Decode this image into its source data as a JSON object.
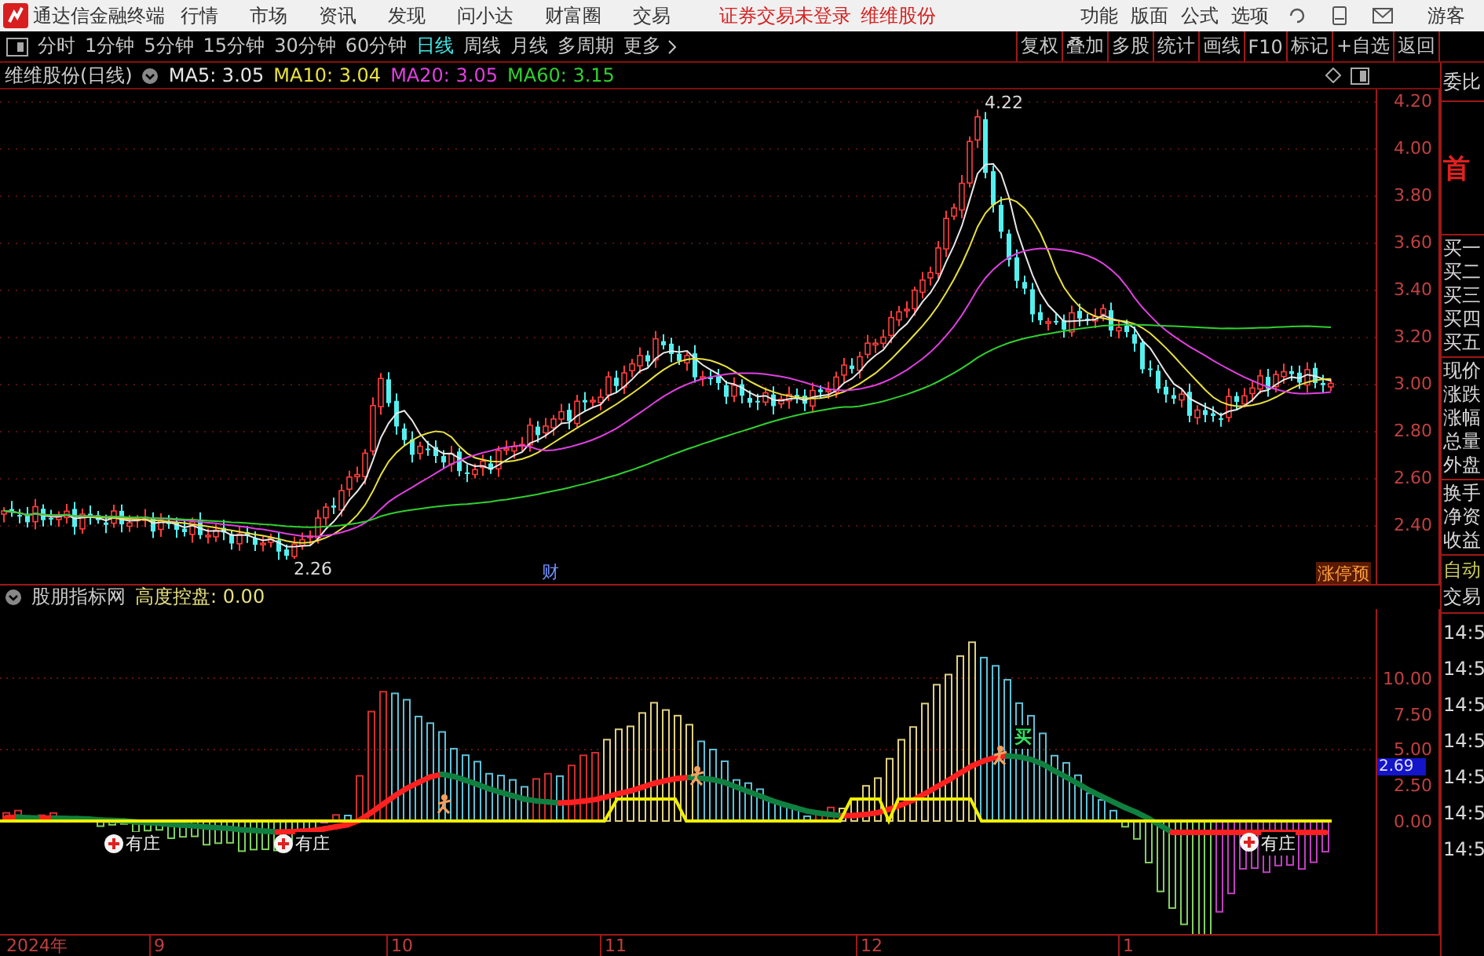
{
  "menu_bar": {
    "app_title": "通达信金融终端",
    "menus": [
      "行情",
      "市场",
      "资讯",
      "发现",
      "问小达",
      "财富圈",
      "交易"
    ],
    "login_status": "证券交易未登录",
    "stock_name": "维维股份",
    "right_menus": [
      "功能",
      "版面",
      "公式",
      "选项"
    ],
    "user": "游客"
  },
  "period_bar": {
    "periods": [
      {
        "label": "分时",
        "selected": false
      },
      {
        "label": "1分钟",
        "selected": false
      },
      {
        "label": "5分钟",
        "selected": false
      },
      {
        "label": "15分钟",
        "selected": false
      },
      {
        "label": "30分钟",
        "selected": false
      },
      {
        "label": "60分钟",
        "selected": false
      },
      {
        "label": "日线",
        "selected": true
      },
      {
        "label": "周线",
        "selected": false
      },
      {
        "label": "月线",
        "selected": false
      },
      {
        "label": "多周期",
        "selected": false
      },
      {
        "label": "更多",
        "selected": false
      }
    ],
    "tools": [
      "复权",
      "叠加",
      "多股",
      "统计",
      "画线",
      "F10",
      "标记",
      "+自选",
      "返回"
    ]
  },
  "price_chart": {
    "title": "维维股份(日线)",
    "ma": [
      {
        "label": "MA5: 3.05",
        "color": "#e8e8e8"
      },
      {
        "label": "MA10: 3.04",
        "color": "#e8e040"
      },
      {
        "label": "MA20: 3.05",
        "color": "#e040e0"
      },
      {
        "label": "MA60: 3.15",
        "color": "#30d030"
      }
    ],
    "y_labels": [
      "4.20",
      "4.00",
      "3.80",
      "3.60",
      "3.40",
      "3.20",
      "3.00",
      "2.80",
      "2.60",
      "2.40"
    ],
    "high_label": "4.22",
    "low_label": "2.26",
    "event_mark": "财",
    "badge": "涨停预"
  },
  "indicator": {
    "title": "股朋指标网",
    "value_label": "高度控盘: 0.00",
    "y_labels": [
      "10.00",
      "7.50",
      "5.00",
      "2.50",
      "0.00"
    ],
    "current_value": "2.69",
    "signals": [
      {
        "kind": "zhuang",
        "text": "有庄"
      },
      {
        "kind": "zhuang",
        "text": "有庄"
      },
      {
        "kind": "zhuang",
        "text": "有庄"
      },
      {
        "kind": "buy",
        "text": "买"
      }
    ]
  },
  "date_axis": [
    "2024年",
    "9",
    "10",
    "11",
    "12",
    "1"
  ],
  "quote_panel": {
    "sections": [
      {
        "kind": "header",
        "items": [
          "委比"
        ]
      },
      {
        "kind": "banner",
        "items": [
          "首"
        ]
      },
      {
        "kind": "rows",
        "items": [
          "买一",
          "买二",
          "买三",
          "买四",
          "买五"
        ]
      },
      {
        "kind": "rows",
        "items": [
          "现价",
          "涨跌",
          "涨幅",
          "总量",
          "外盘"
        ]
      },
      {
        "kind": "rows",
        "items": [
          "换手",
          "净资",
          "收益"
        ]
      },
      {
        "kind": "auto",
        "items": [
          "自动",
          "交易"
        ]
      },
      {
        "kind": "time",
        "items": [
          "14:5",
          "14:5",
          "14:5",
          "14:5",
          "14:5",
          "14:5",
          "14:5"
        ]
      }
    ]
  }
}
